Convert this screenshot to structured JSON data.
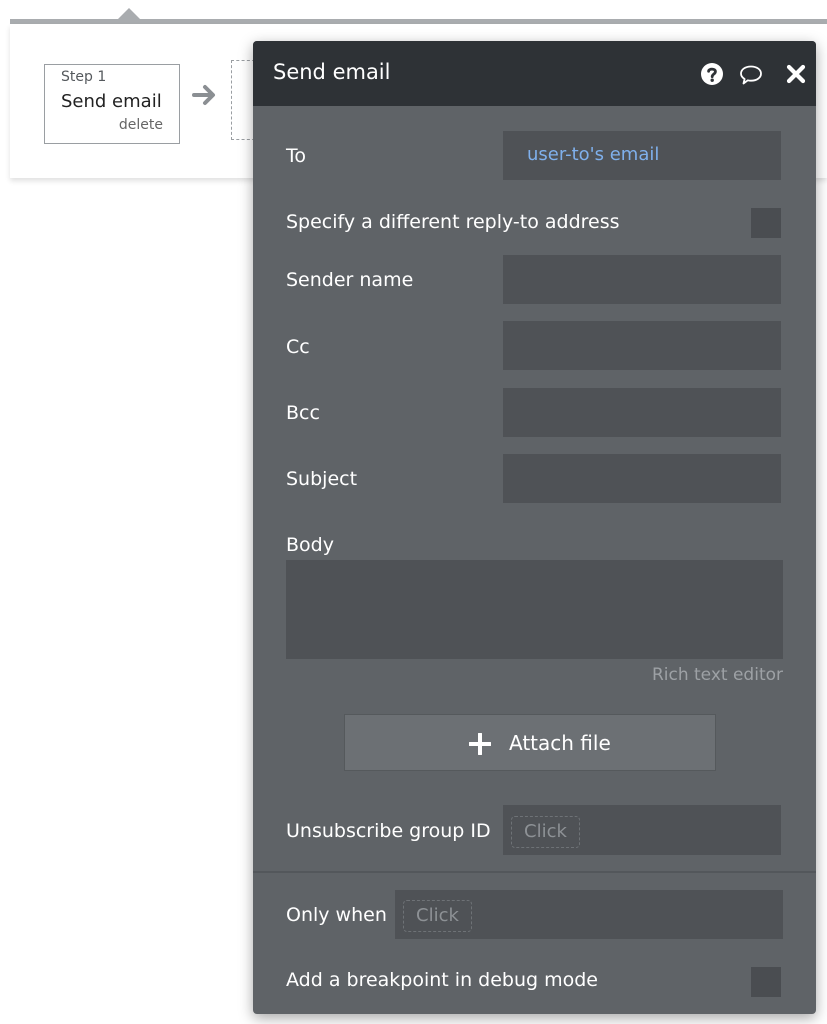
{
  "workflow": {
    "step_number": "Step 1",
    "step_title": "Send email",
    "step_delete": "delete"
  },
  "panel": {
    "title": "Send email",
    "icons": [
      "help-icon",
      "comment-icon",
      "close-icon"
    ],
    "to_label": "To",
    "to_value": "user-to's email",
    "reply_to_label": "Specify a different reply-to address",
    "reply_to_checked": false,
    "sender_name_label": "Sender name",
    "sender_name_value": "",
    "cc_label": "Cc",
    "cc_value": "",
    "bcc_label": "Bcc",
    "bcc_value": "",
    "subject_label": "Subject",
    "subject_value": "",
    "body_label": "Body",
    "body_value": "",
    "rich_text_editor_label": "Rich text editor",
    "attach_file_label": "Attach file",
    "unsubscribe_label": "Unsubscribe group ID",
    "unsubscribe_placeholder": "Click",
    "only_when_label": "Only when",
    "only_when_placeholder": "Click",
    "breakpoint_label": "Add a breakpoint in debug mode",
    "breakpoint_checked": false
  },
  "colors": {
    "panel_bg": "#5f6367",
    "header_bg": "#2e3236",
    "field_bg": "#4f5256",
    "dynamic_value": "#7fb0ec"
  }
}
